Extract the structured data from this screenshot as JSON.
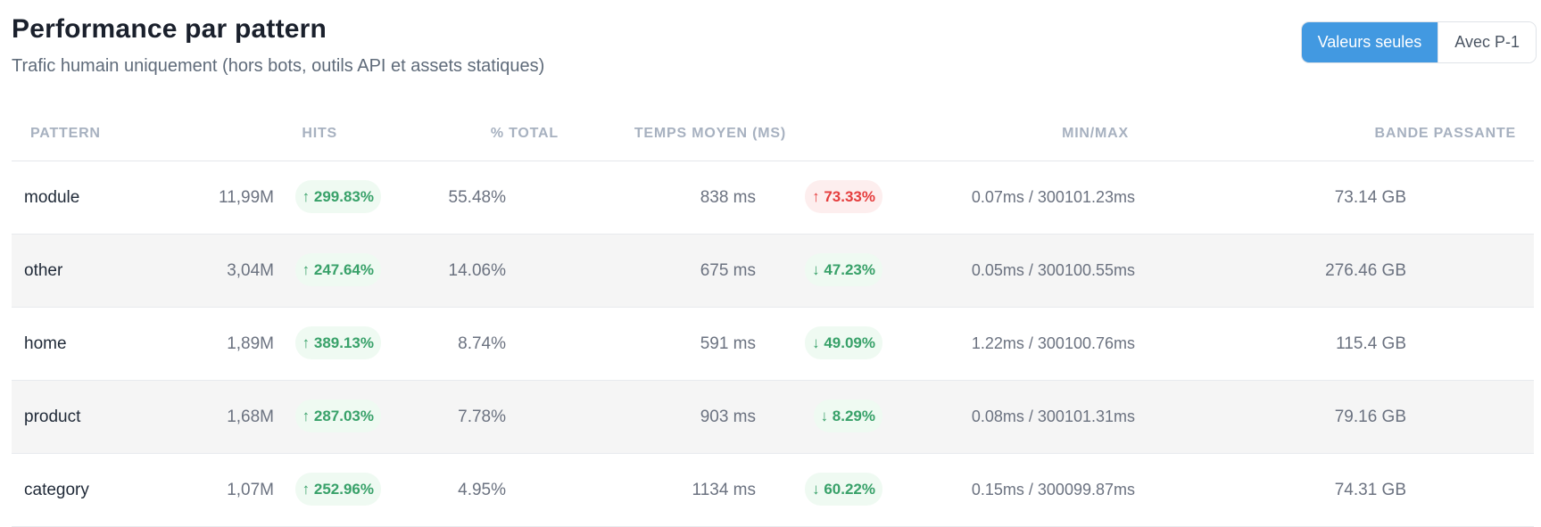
{
  "header": {
    "title": "Performance par pattern",
    "subtitle": "Trafic humain uniquement (hors bots, outils API et assets statiques)"
  },
  "toggle": {
    "options": [
      "Valeurs seules",
      "Avec P-1"
    ],
    "active": "Valeurs seules",
    "accent_color": "#4299e1"
  },
  "table": {
    "columns": {
      "pattern": "PATTERN",
      "hits": "HITS",
      "total": "% TOTAL",
      "time": "TEMPS MOYEN (MS)",
      "minmax": "MIN/MAX",
      "bandwidth": "BANDE PASSANTE"
    },
    "rows": [
      {
        "pattern": "module",
        "hits": "11,99M",
        "hits_change": "↑ 299.83%",
        "hits_trend": "green",
        "total": "55.48%",
        "time": "838 ms",
        "time_change": "↑ 73.33%",
        "time_trend": "red",
        "minmax": "0.07ms / 300101.23ms",
        "bandwidth": "73.14 GB"
      },
      {
        "pattern": "other",
        "hits": "3,04M",
        "hits_change": "↑ 247.64%",
        "hits_trend": "green",
        "total": "14.06%",
        "time": "675 ms",
        "time_change": "↓ 47.23%",
        "time_trend": "green",
        "minmax": "0.05ms / 300100.55ms",
        "bandwidth": "276.46 GB"
      },
      {
        "pattern": "home",
        "hits": "1,89M",
        "hits_change": "↑ 389.13%",
        "hits_trend": "green",
        "total": "8.74%",
        "time": "591 ms",
        "time_change": "↓ 49.09%",
        "time_trend": "green",
        "minmax": "1.22ms / 300100.76ms",
        "bandwidth": "115.4 GB"
      },
      {
        "pattern": "product",
        "hits": "1,68M",
        "hits_change": "↑ 287.03%",
        "hits_trend": "green",
        "total": "7.78%",
        "time": "903 ms",
        "time_change": "↓ 8.29%",
        "time_trend": "green",
        "minmax": "0.08ms / 300101.31ms",
        "bandwidth": "79.16 GB"
      },
      {
        "pattern": "category",
        "hits": "1,07M",
        "hits_change": "↑ 252.96%",
        "hits_trend": "green",
        "total": "4.95%",
        "time": "1134 ms",
        "time_change": "↓ 60.22%",
        "time_trend": "green",
        "minmax": "0.15ms / 300099.87ms",
        "bandwidth": "74.31 GB"
      }
    ]
  },
  "colors": {
    "positive": "#38a169",
    "negative": "#e53e3e",
    "header_text": "#a7b1c0",
    "alt_row": "#f5f5f5"
  }
}
